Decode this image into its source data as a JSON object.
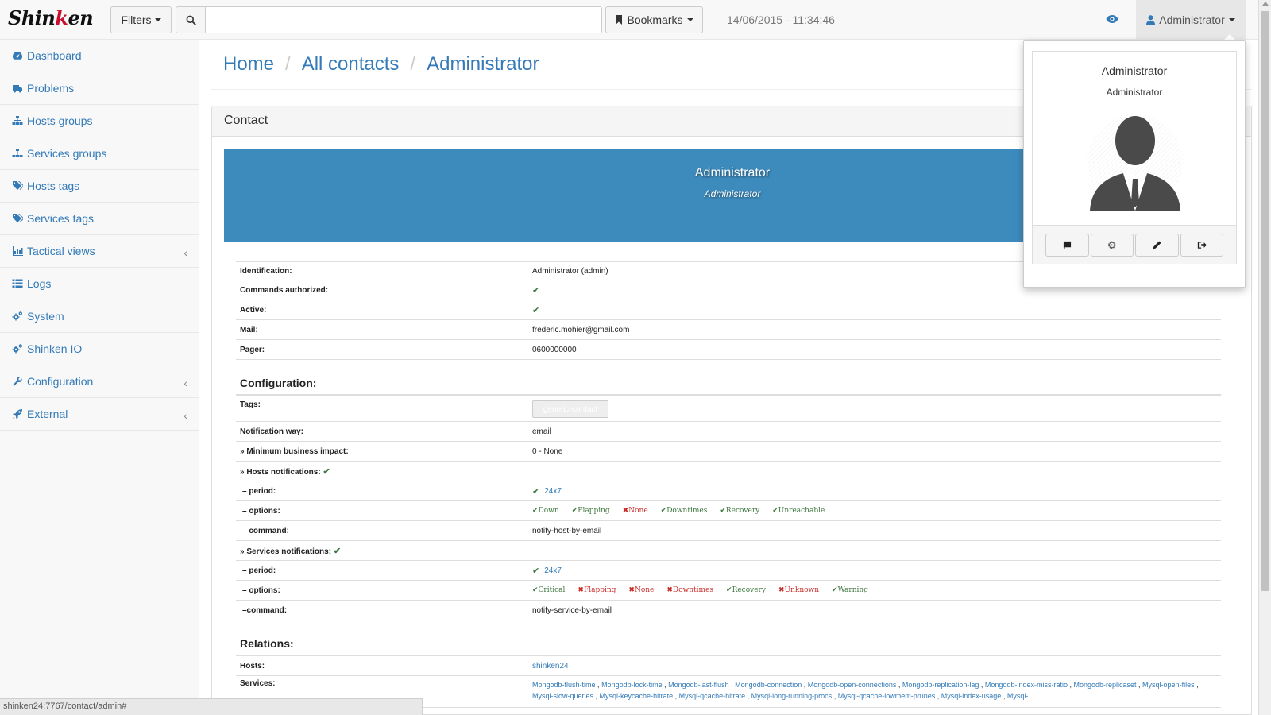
{
  "navbar": {
    "logo_main": "Shin",
    "logo_accent": "k",
    "logo_tail": "en",
    "filters_label": "Filters",
    "search_placeholder": "",
    "bookmarks_label": "Bookmarks",
    "datetime": "14/06/2015 - 11:34:46",
    "user_label": "Administrator"
  },
  "sidebar": {
    "items": [
      {
        "label": "Dashboard",
        "icon": "dashboard-icon"
      },
      {
        "label": "Problems",
        "icon": "ambulance-icon"
      },
      {
        "label": "Hosts groups",
        "icon": "sitemap-icon"
      },
      {
        "label": "Services groups",
        "icon": "sitemap-icon"
      },
      {
        "label": "Hosts tags",
        "icon": "tags-icon"
      },
      {
        "label": "Services tags",
        "icon": "tags-icon"
      },
      {
        "label": "Tactical views",
        "icon": "bar-chart-icon",
        "expandable": true
      },
      {
        "label": "Logs",
        "icon": "list-icon"
      },
      {
        "label": "System",
        "icon": "gears-icon"
      },
      {
        "label": "Shinken IO",
        "icon": "gears-icon"
      },
      {
        "label": "Configuration",
        "icon": "wrench-icon",
        "expandable": true
      },
      {
        "label": "External",
        "icon": "rocket-icon",
        "expandable": true
      }
    ]
  },
  "breadcrumb": {
    "home": "Home",
    "contacts": "All contacts",
    "current": "Administrator",
    "separator": "/"
  },
  "panel": {
    "heading": "Contact",
    "banner_name": "Administrator",
    "banner_role": "Administrator"
  },
  "details": {
    "identification_label": "Identification:",
    "identification_value": "Administrator (admin)",
    "commands_label": "Commands authorized:",
    "active_label": "Active:",
    "mail_label": "Mail:",
    "mail_value": "frederic.mohier@gmail.com",
    "pager_label": "Pager:",
    "pager_value": "0600000000",
    "configuration_title": "Configuration:",
    "tags_label": "Tags:",
    "tags_value": "generic-contact",
    "notification_way_label": "Notification way:",
    "notification_way_value": "email",
    "min_impact_label": "» Minimum business impact:",
    "min_impact_value": "0 - None",
    "hosts_notif_label": "» Hosts notifications:",
    "host_period_label": "– period:",
    "host_period_value": "24x7",
    "host_options_label": "– options:",
    "host_options": [
      {
        "label": "Down",
        "enabled": true
      },
      {
        "label": "Flapping",
        "enabled": true
      },
      {
        "label": "None",
        "enabled": false
      },
      {
        "label": "Downtimes",
        "enabled": true
      },
      {
        "label": "Recovery",
        "enabled": true
      },
      {
        "label": "Unreachable",
        "enabled": true
      }
    ],
    "host_command_label": "– command:",
    "host_command_value": "notify-host-by-email",
    "services_notif_label": "» Services notifications:",
    "service_period_label": "– period:",
    "service_period_value": "24x7",
    "service_options_label": "– options:",
    "service_options": [
      {
        "label": "Critical",
        "enabled": true
      },
      {
        "label": "Flapping",
        "enabled": false
      },
      {
        "label": "None",
        "enabled": false
      },
      {
        "label": "Downtimes",
        "enabled": false
      },
      {
        "label": "Recovery",
        "enabled": true
      },
      {
        "label": "Unknown",
        "enabled": false
      },
      {
        "label": "Warning",
        "enabled": true
      }
    ],
    "service_command_label": "–command:",
    "service_command_value": "notify-service-by-email",
    "relations_title": "Relations:",
    "hosts_label": "Hosts:",
    "hosts_value": "shinken24",
    "services_label": "Services:",
    "services": [
      "Mongodb-flush-time",
      "Mongodb-lock-time",
      "Mongodb-last-flush",
      "Mongodb-connection",
      "Mongodb-open-connections",
      "Mongodb-replication-lag",
      "Mongodb-index-miss-ratio",
      "Mongodb-replicaset",
      "Mysql-open-files",
      "Mysql-slow-queries",
      "Mysql-keycache-hitrate",
      "Mysql-qcache-hitrate",
      "Mysql-long-running-procs",
      "Mysql-qcache-lowmem-prunes",
      "Mysql-index-usage",
      "Mysql-"
    ]
  },
  "popover": {
    "name": "Administrator",
    "role": "Administrator",
    "actions": [
      "book-icon",
      "gear-icon",
      "pencil-icon",
      "sign-out-icon"
    ]
  },
  "statusbar": {
    "url": "shinken24:7767/contact/admin#"
  }
}
